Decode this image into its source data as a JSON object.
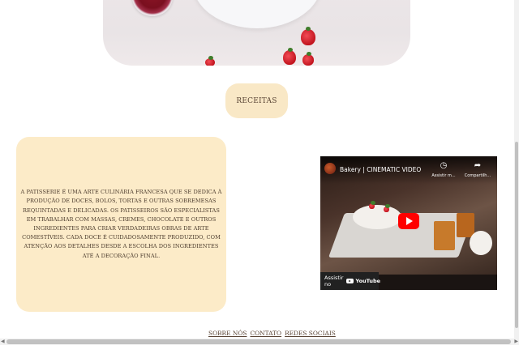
{
  "nav": {
    "receitas_label": "RECEITAS"
  },
  "about": {
    "text": "A patisserie é uma arte culinária francesa que se dedica à produção de doces, bolos, tortas e outras sobremesas requintadas e delicadas. Os patisseiros são especialistas em trabalhar com massas, cremes, chocolate e outros ingredientes para criar verdadeiras obras de arte comestíveis. Cada doce é cuidadosamente produzido, com atenção aos detalhes desde a escolha dos ingredientes até a decoração final."
  },
  "video": {
    "title": "Bakery | CINEMATIC VIDEO",
    "watch_later_label": "Assistir m...",
    "share_label": "Compartilh...",
    "watch_on_label": "Assistir no",
    "platform_label": "YouTube"
  },
  "footer": {
    "links": [
      "SOBRE NÓS",
      "CONTATO",
      "REDES SOCIAIS"
    ]
  },
  "colors": {
    "accent": "#f9e8c6",
    "text": "#5b4636"
  }
}
